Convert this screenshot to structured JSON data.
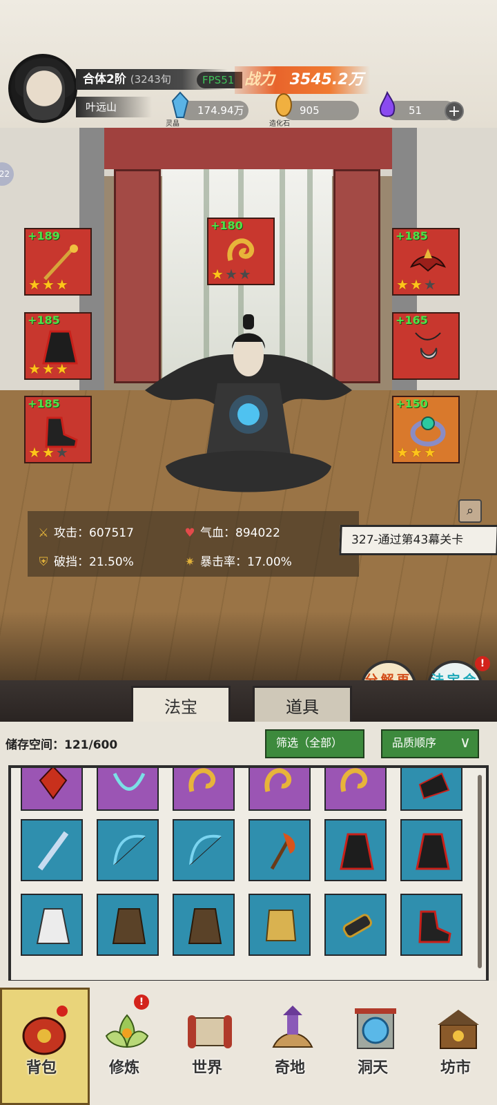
{
  "player": {
    "realm": "合体2阶",
    "exp": "(3243旬",
    "name": "叶远山",
    "fps": "FPS51",
    "power_label": "战力",
    "power_value": "3545.2万"
  },
  "resources": [
    {
      "icon": "spirit-crystal-icon",
      "label": "灵晶",
      "value": "174.94万"
    },
    {
      "icon": "creation-stone-icon",
      "label": "造化石",
      "value": "905"
    },
    {
      "icon": "purple-flame-icon",
      "label": "",
      "value": "51"
    }
  ],
  "side_badge": "22",
  "equipment": [
    {
      "slot": "weapon",
      "level": "+189",
      "stars": 3,
      "color": "red"
    },
    {
      "slot": "talisman",
      "level": "+180",
      "stars": 1,
      "color": "red"
    },
    {
      "slot": "helmet",
      "level": "+185",
      "stars": 2,
      "color": "red"
    },
    {
      "slot": "armor",
      "level": "+185",
      "stars": 3,
      "color": "red"
    },
    {
      "slot": "necklace",
      "level": "+165",
      "stars": 0,
      "color": "red"
    },
    {
      "slot": "boots",
      "level": "+185",
      "stars": 2,
      "color": "red"
    },
    {
      "slot": "ring",
      "level": "+150",
      "stars": 3,
      "color": "orange"
    }
  ],
  "stats": {
    "attack": "攻击：607517",
    "hp": "气血：894022",
    "break": "破挡：21.50%",
    "crit": "暴击率：17.00%"
  },
  "toast": "327-通过第43幕关卡",
  "actions": {
    "decompose": "分解再造",
    "synthesize": "法宝合成",
    "alert": "!"
  },
  "tabs": {
    "treasure": "法宝",
    "items": "道具"
  },
  "inventory": {
    "storage": "储存空间：121/600",
    "filter": "筛选（全部）",
    "sort": "品质顺序",
    "items": [
      {
        "icon": "red-amulet-icon",
        "quality": "purple"
      },
      {
        "icon": "cyan-necklace-icon",
        "quality": "purple"
      },
      {
        "icon": "gold-talisman-icon",
        "quality": "purple"
      },
      {
        "icon": "gold-talisman-icon",
        "quality": "purple"
      },
      {
        "icon": "gold-talisman-icon",
        "quality": "purple"
      },
      {
        "icon": "dark-shoe-icon",
        "quality": "blue"
      },
      {
        "icon": "ice-sword-icon",
        "quality": "blue"
      },
      {
        "icon": "bow-icon",
        "quality": "blue"
      },
      {
        "icon": "bow-icon",
        "quality": "blue"
      },
      {
        "icon": "fire-axe-icon",
        "quality": "blue"
      },
      {
        "icon": "red-robe-icon",
        "quality": "blue"
      },
      {
        "icon": "red-robe-icon",
        "quality": "blue"
      },
      {
        "icon": "white-robe-icon",
        "quality": "blue"
      },
      {
        "icon": "brown-cloak-icon",
        "quality": "blue"
      },
      {
        "icon": "brown-cloak-icon",
        "quality": "blue"
      },
      {
        "icon": "gold-armor-icon",
        "quality": "blue"
      },
      {
        "icon": "gauntlet-icon",
        "quality": "blue"
      },
      {
        "icon": "dark-boot-icon",
        "quality": "blue"
      }
    ]
  },
  "nav": [
    {
      "label": "背包",
      "icon": "bag-icon",
      "active": true
    },
    {
      "label": "修炼",
      "icon": "lotus-icon",
      "alert": "!"
    },
    {
      "label": "世界",
      "icon": "scroll-map-icon"
    },
    {
      "label": "奇地",
      "icon": "pagoda-icon"
    },
    {
      "label": "洞天",
      "icon": "portal-icon"
    },
    {
      "label": "坊市",
      "icon": "market-icon"
    }
  ],
  "colors": {
    "slot_red": "#c8372e",
    "slot_orange": "#d9792c",
    "item_purple": "#9b55b4",
    "item_blue": "#2f8fae",
    "level_green": "#4fe24a",
    "star_gold": "#ffc41a",
    "button_green": "#3d8a3d"
  }
}
